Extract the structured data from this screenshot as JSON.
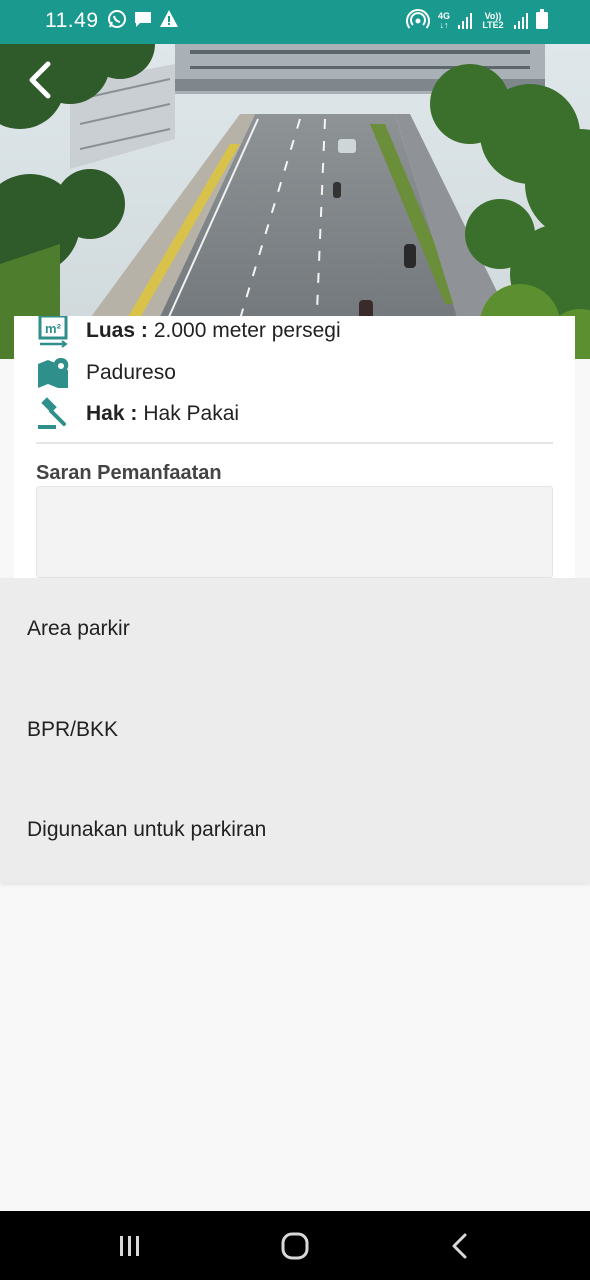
{
  "status_bar": {
    "time": "11.49",
    "network": "4G",
    "volte": "Vo)) LTE2",
    "color": "#1a9a8f"
  },
  "header": {
    "back_icon": "chevron-left-icon"
  },
  "detail": {
    "area": {
      "label": "Luas :",
      "value": "2.000 meter persegi",
      "icon": "area-m2-icon"
    },
    "location": {
      "value": "Padureso",
      "icon": "map-pin-icon"
    },
    "rights": {
      "label": "Hak :",
      "value": "Hak Pakai",
      "icon": "gavel-icon"
    },
    "suggestion_title": "Saran Pemanfaatan",
    "suggestion_value": ""
  },
  "suggestions": [
    "Area parkir",
    "BPR/BKK",
    "Digunakan untuk parkiran"
  ],
  "nav": {
    "recent_icon": "recent-apps-icon",
    "home_icon": "home-icon",
    "back_icon": "back-icon"
  },
  "colors": {
    "accent": "#1a9a8f",
    "icon_teal": "#2f8f8a"
  }
}
